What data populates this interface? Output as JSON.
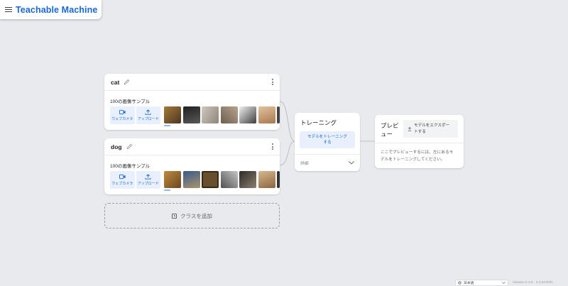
{
  "app": {
    "title": "Teachable Machine"
  },
  "classes": [
    {
      "name": "cat",
      "samples_label": "100の画像サンプル",
      "webcam_label": "ウェブカメラ",
      "upload_label": "アップロード",
      "thumb_colors": [
        "#7a5a2e",
        "#2b2b2b",
        "#b8b2ab",
        "#8a7b6c",
        "#e2e2e2",
        "#c9a27e",
        "#4a4a4a"
      ]
    },
    {
      "name": "dog",
      "samples_label": "100の画像サンプル",
      "webcam_label": "ウェブカメラ",
      "upload_label": "アップロード",
      "thumb_colors": [
        "#9c6a2a",
        "#7d7468",
        "#6a4f2d",
        "#8c8c8c",
        "#5c5650",
        "#b08860",
        "#3a3a3a"
      ]
    }
  ],
  "add_class": {
    "label": "クラスを追加"
  },
  "training": {
    "title": "トレーニング",
    "button_line1": "モデルをトレーニング",
    "button_line2": "する",
    "advanced_label": "詳細"
  },
  "preview": {
    "title_line1": "プレビ",
    "title_line2": "ュー",
    "export_line1": "モデルをエクスポー",
    "export_line2": "トする",
    "message_line1": "ここでプレビューするには、左にあるモ",
    "message_line2": "デルをトレーニングしてください。"
  },
  "footer": {
    "language": "日本語",
    "version": "release-2-4-5 - 2.4.5#1f0f1"
  },
  "colors": {
    "brand": "#1967d2",
    "button_bg": "#e8f0fe",
    "background": "#e8eaed"
  }
}
